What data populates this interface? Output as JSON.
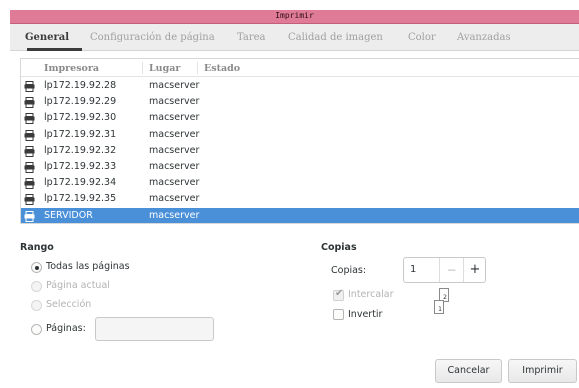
{
  "window": {
    "title": "Imprimir"
  },
  "tabs": [
    {
      "label": "General",
      "active": true
    },
    {
      "label": "Configuración de página",
      "active": false
    },
    {
      "label": "Tarea",
      "active": false
    },
    {
      "label": "Calidad de imagen",
      "active": false
    },
    {
      "label": "Color",
      "active": false
    },
    {
      "label": "Avanzadas",
      "active": false
    }
  ],
  "printer_list": {
    "columns": [
      "Impresora",
      "Lugar",
      "Estado"
    ],
    "rows": [
      {
        "name": "lp172.19.92.28",
        "location": "macserver",
        "status": "",
        "selected": false
      },
      {
        "name": "lp172.19.92.29",
        "location": "macserver",
        "status": "",
        "selected": false
      },
      {
        "name": "lp172.19.92.30",
        "location": "macserver",
        "status": "",
        "selected": false
      },
      {
        "name": "lp172.19.92.31",
        "location": "macserver",
        "status": "",
        "selected": false
      },
      {
        "name": "lp172.19.92.32",
        "location": "macserver",
        "status": "",
        "selected": false
      },
      {
        "name": "lp172.19.92.33",
        "location": "macserver",
        "status": "",
        "selected": false
      },
      {
        "name": "lp172.19.92.34",
        "location": "macserver",
        "status": "",
        "selected": false
      },
      {
        "name": "lp172.19.92.35",
        "location": "macserver",
        "status": "",
        "selected": false
      },
      {
        "name": "SERVIDOR",
        "location": "macserver",
        "status": "",
        "selected": true
      }
    ],
    "row_icon": "printer-icon",
    "selection_color": "#4a90d9"
  },
  "range": {
    "title": "Rango",
    "options": [
      {
        "label": "Todas las páginas",
        "checked": true,
        "enabled": true
      },
      {
        "label": "Página actual",
        "checked": false,
        "enabled": false
      },
      {
        "label": "Selección",
        "checked": false,
        "enabled": false
      },
      {
        "label": "Páginas:",
        "checked": false,
        "enabled": true
      }
    ],
    "pages_value": ""
  },
  "copies": {
    "title": "Copias",
    "label": "Copias:",
    "value": "1",
    "minus": "−",
    "plus": "+",
    "collate_label": "Intercalar",
    "collate_checked": true,
    "collate_enabled": false,
    "reverse_label": "Invertir",
    "reverse_checked": false,
    "collate_preview": [
      "1",
      "2"
    ]
  },
  "buttons": {
    "cancel": "Cancelar",
    "print": "Imprimir"
  },
  "colors": {
    "titlebar": "#df7b97",
    "tabbar": "#ededed",
    "selection": "#4a90d9"
  }
}
